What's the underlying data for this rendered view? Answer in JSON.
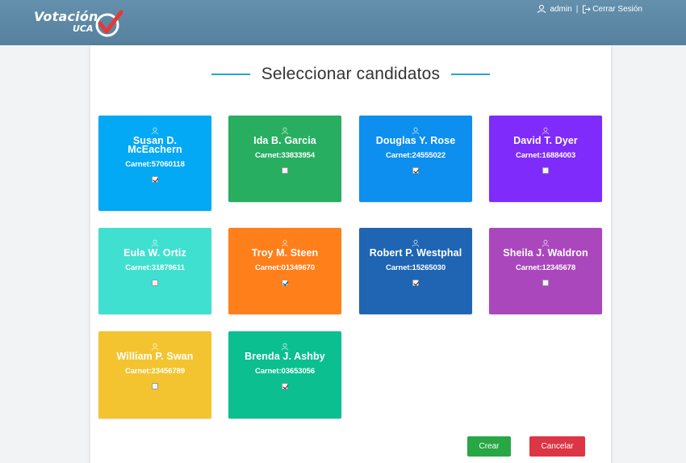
{
  "app": {
    "logo_line1": "Votación",
    "logo_line2": "UCA",
    "user_name": "admin",
    "separator": "|",
    "logout_label": "Cerrar Sesión"
  },
  "page": {
    "title": "Seleccionar candidatos"
  },
  "colors": {
    "navbar": "#5d8aa8",
    "title_accent": "#26a3d3",
    "crear": "#28a745",
    "cancelar": "#dc3545"
  },
  "candidates": [
    {
      "name": "Susan D. McEachern",
      "carnet": "Carnet:57060118",
      "checked": true,
      "color": "#03a9f4",
      "icon": "user-icon"
    },
    {
      "name": "Ida B. Garcia",
      "carnet": "Carnet:33833954",
      "checked": false,
      "color": "#27ae60",
      "icon": "user-icon"
    },
    {
      "name": "Douglas Y. Rose",
      "carnet": "Carnet:24555022",
      "checked": true,
      "color": "#0d8fef",
      "icon": "user-icon"
    },
    {
      "name": "David T. Dyer",
      "carnet": "Carnet:16884003",
      "checked": false,
      "color": "#7e2bfb",
      "icon": "user-icon"
    },
    {
      "name": "Eula W. Ortiz",
      "carnet": "Carnet:31879611",
      "checked": false,
      "color": "#40e0d0",
      "icon": "user-icon"
    },
    {
      "name": "Troy M. Steen",
      "carnet": "Carnet:01349670",
      "checked": true,
      "color": "#ff7f1a",
      "icon": "user-icon"
    },
    {
      "name": "Robert P. Westphal",
      "carnet": "Carnet:15265030",
      "checked": true,
      "color": "#1f65b4",
      "icon": "user-icon"
    },
    {
      "name": "Sheila J. Waldron",
      "carnet": "Carnet:12345678",
      "checked": false,
      "color": "#ab47bc",
      "icon": "user-icon"
    },
    {
      "name": "William P. Swan",
      "carnet": "Carnet:23456789",
      "checked": false,
      "color": "#f4c430",
      "icon": "user-icon"
    },
    {
      "name": "Brenda J. Ashby",
      "carnet": "Carnet:03653056",
      "checked": true,
      "color": "#0bbf91",
      "icon": "user-icon"
    }
  ],
  "actions": {
    "crear_label": "Crear",
    "cancelar_label": "Cancelar"
  }
}
